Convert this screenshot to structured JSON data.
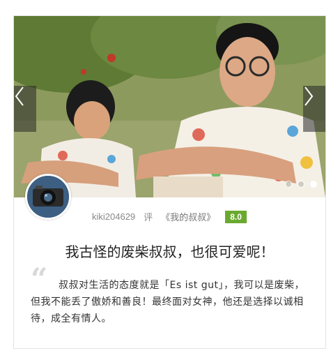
{
  "hero": {
    "prev_icon": "chevron-left-icon",
    "next_icon": "chevron-right-icon",
    "slides": 3,
    "active_slide": 2
  },
  "review": {
    "username": "kiki204629",
    "verb": "评",
    "movie": "《我的叔叔》",
    "rating": "8.0",
    "rating_color": "#6aa92f",
    "title": "我古怪的废柴叔叔，也很可爱呢！",
    "quote_mark": "“",
    "excerpt": "叔叔对生活的态度就是「Es ist gut」，我可以是废柴，但我不能丢了傲娇和善良！最终面对女神，他还是选择以诚相待，成全有情人。"
  }
}
